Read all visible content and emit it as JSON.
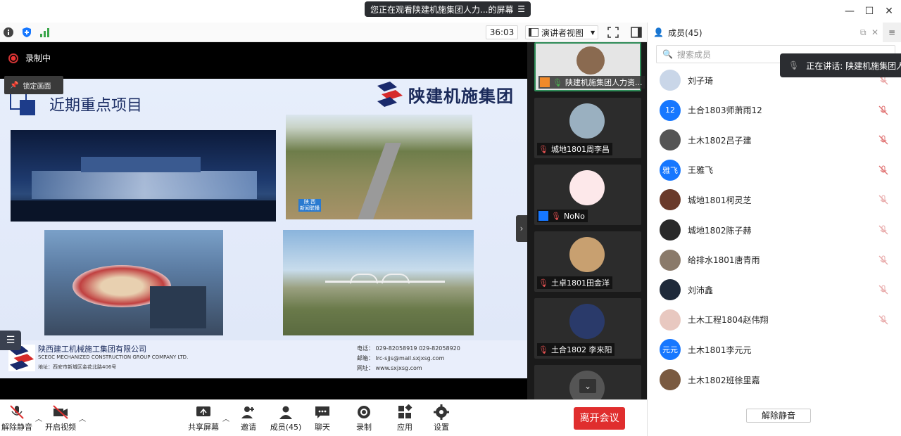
{
  "window": {
    "banner": "您正在观看陕建机施集团人力...的屏幕",
    "minimize": "—",
    "maximize": "☐",
    "close": "✕"
  },
  "toolbar": {
    "timer": "36:03",
    "view_mode": "演讲者视图"
  },
  "stage": {
    "recording_label": "录制中",
    "pin_label": "锁定画面",
    "slide": {
      "title": "近期重点项目",
      "brand": "陕建机施集团",
      "photo_badge_1": "陕 西",
      "photo_badge_2": "新闻联播",
      "footer": {
        "company_cn": "陕西建工机械施工集团有限公司",
        "company_en": "SCEGC MECHANIZED CONSTRUCTION GROUP COMPANY LTD.",
        "address": "地址：西安市新城区金花北路406号",
        "phone": "电话：  029-82058919          029-82058920",
        "email": "邮箱：  lrc-sjjs@mail.sxjxsg.com",
        "website": "网址：  www.sxjxsg.com"
      }
    }
  },
  "gallery": {
    "tiles": [
      {
        "name": "陕建机施集团人力资..."
      },
      {
        "name": "城地1801周李昌"
      },
      {
        "name": "NoNo"
      },
      {
        "name": "土卓1801田金洋"
      },
      {
        "name": "土合1802 李来阳"
      }
    ]
  },
  "panel": {
    "title": "成员(45)",
    "search_placeholder": "搜索成员",
    "speaking": "正在讲话: 陕建机施集团人力",
    "members": [
      {
        "name": "刘子琦",
        "avatar_text": "",
        "avatar_color": "#c9d6e8",
        "muted_color": "#e8a0a0"
      },
      {
        "name": "土合1803师萧雨12",
        "avatar_text": "12",
        "avatar_color": "#1677ff",
        "muted_color": "#e07070"
      },
      {
        "name": "土木1802吕子建",
        "avatar_text": "",
        "avatar_color": "#555555",
        "muted_color": "#e07070"
      },
      {
        "name": "王雅飞",
        "avatar_text": "雅飞",
        "avatar_color": "#1677ff",
        "muted_color": "#e07070"
      },
      {
        "name": "城地1801柯灵芝",
        "avatar_text": "",
        "avatar_color": "#6a3a2a",
        "muted_color": "#e8a8a8"
      },
      {
        "name": "城地1802陈子赫",
        "avatar_text": "",
        "avatar_color": "#2a2a2a",
        "muted_color": "#e8a8a8"
      },
      {
        "name": "给排水1801唐青雨",
        "avatar_text": "",
        "avatar_color": "#8a7a6a",
        "muted_color": "#e8a8a8"
      },
      {
        "name": "刘沛鑫",
        "avatar_text": "",
        "avatar_color": "#1f2a3a",
        "muted_color": "#e8a8a8"
      },
      {
        "name": "土木工程1804赵伟翔",
        "avatar_text": "",
        "avatar_color": "#e8c8c0",
        "muted_color": "#e8a8a8"
      },
      {
        "name": "土木1801李元元",
        "avatar_text": "元元",
        "avatar_color": "#1677ff",
        "muted_color": ""
      },
      {
        "name": "土木1802班徐里嘉",
        "avatar_text": "",
        "avatar_color": "#7a5a40",
        "muted_color": ""
      }
    ],
    "unmute_all": "解除静音"
  },
  "bottom": {
    "unmute": "解除静音",
    "start_video": "开启视频",
    "share": "共享屏幕",
    "invite": "邀请",
    "members": "成员(45)",
    "chat": "聊天",
    "record": "录制",
    "apps": "应用",
    "settings": "设置",
    "leave": "离开会议"
  },
  "colors": {
    "accent": "#1677ff",
    "leave": "#e02e2e",
    "muted": "#e07070",
    "active_tile": "#2e8b57"
  }
}
